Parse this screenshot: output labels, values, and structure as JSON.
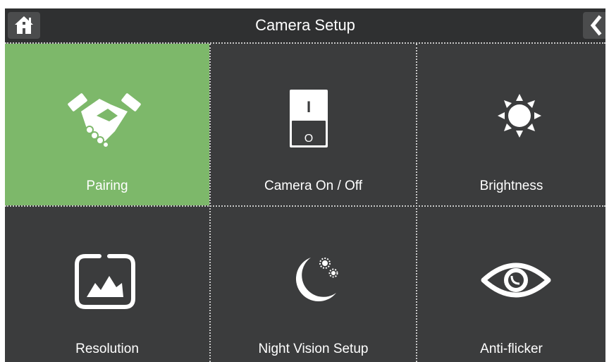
{
  "header": {
    "title": "Camera Setup",
    "home_icon": "home-icon",
    "back_icon": "chevron-left-icon"
  },
  "menu": {
    "selected": "Pairing",
    "colors": {
      "selected_tile": "#7db86a",
      "tile": "#3b3c3d",
      "background": "#2f3031"
    },
    "items": [
      {
        "label": "Pairing",
        "icon": "handshake-icon"
      },
      {
        "label": "Camera On / Off",
        "icon": "power-switch-icon",
        "switch_on": "I",
        "switch_off": "O"
      },
      {
        "label": "Brightness",
        "icon": "sun-icon"
      },
      {
        "label": "Resolution",
        "icon": "image-icon"
      },
      {
        "label": "Night Vision Setup",
        "icon": "moon-icon"
      },
      {
        "label": "Anti-flicker",
        "icon": "eye-icon"
      }
    ]
  }
}
